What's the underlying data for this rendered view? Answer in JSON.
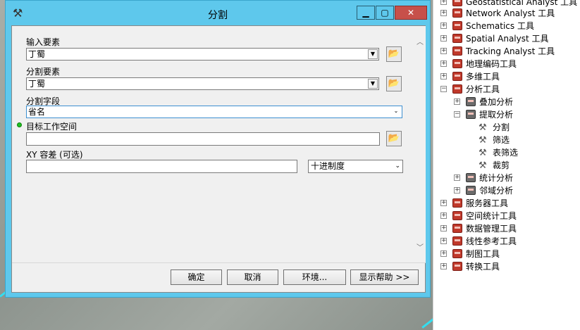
{
  "dialog": {
    "title": "分割",
    "fields": {
      "input_label": "输入要素",
      "input_value": "丁蜀",
      "split_label": "分割要素",
      "split_value": "丁蜀",
      "field_label": "分割字段",
      "field_value": "省名",
      "workspace_label": "目标工作空间",
      "workspace_value": "",
      "xy_label": "XY 容差 (可选)",
      "xy_value": "",
      "unit_value": "十进制度"
    },
    "buttons": {
      "ok": "确定",
      "cancel": "取消",
      "env": "环境...",
      "help": "显示帮助 >>"
    }
  },
  "tree": {
    "items": [
      {
        "label": "Geostatistical Analyst 工具",
        "expander": "+"
      },
      {
        "label": "Network Analyst 工具",
        "expander": "+"
      },
      {
        "label": "Schematics 工具",
        "expander": "+"
      },
      {
        "label": "Spatial Analyst 工具",
        "expander": "+"
      },
      {
        "label": "Tracking Analyst 工具",
        "expander": "+"
      },
      {
        "label": "地理编码工具",
        "expander": "+"
      },
      {
        "label": "多维工具",
        "expander": "+"
      },
      {
        "label": "分析工具",
        "expander": "−"
      },
      {
        "label": "叠加分析",
        "expander": "+"
      },
      {
        "label": "提取分析",
        "expander": "−"
      },
      {
        "label": "分割",
        "expander": ""
      },
      {
        "label": "筛选",
        "expander": ""
      },
      {
        "label": "表筛选",
        "expander": ""
      },
      {
        "label": "裁剪",
        "expander": ""
      },
      {
        "label": "统计分析",
        "expander": "+"
      },
      {
        "label": "邻域分析",
        "expander": "+"
      },
      {
        "label": "服务器工具",
        "expander": "+"
      },
      {
        "label": "空间统计工具",
        "expander": "+"
      },
      {
        "label": "数据管理工具",
        "expander": "+"
      },
      {
        "label": "线性参考工具",
        "expander": "+"
      },
      {
        "label": "制图工具",
        "expander": "+"
      },
      {
        "label": "转换工具",
        "expander": "+"
      }
    ]
  },
  "icons": {
    "title_icon": "hammer-icon",
    "folder_icon": "folder-open-icon",
    "toolbox_icon": "toolbox-icon",
    "tool_icon": "hammer-icon"
  }
}
